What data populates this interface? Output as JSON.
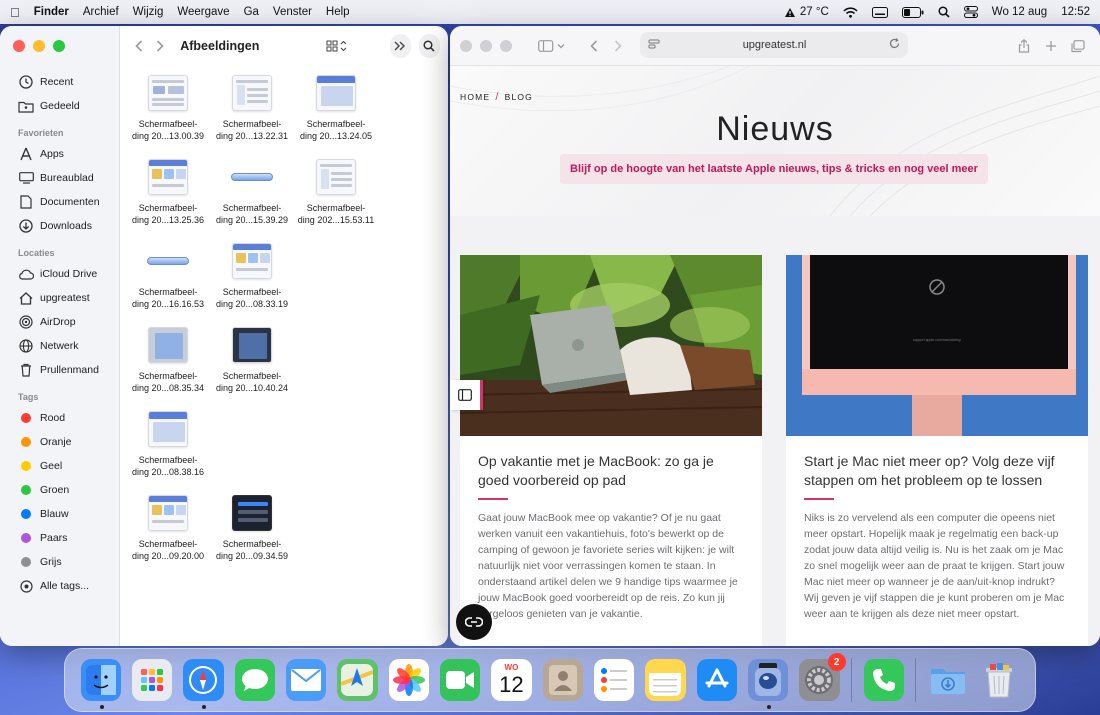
{
  "menubar": {
    "app_name": "Finder",
    "menus": [
      "Archief",
      "Wijzig",
      "Weergave",
      "Ga",
      "Venster",
      "Help"
    ],
    "weather": "27 °C",
    "date": "Wo 12 aug",
    "time": "12:52"
  },
  "finder": {
    "title": "Afbeeldingen",
    "sidebar": {
      "top_items": [
        {
          "label": "Recent",
          "icon": "clock-icon"
        },
        {
          "label": "Gedeeld",
          "icon": "shared-folder-icon"
        }
      ],
      "favorites_header": "Favorieten",
      "favorites": [
        {
          "label": "Apps",
          "icon": "apps-icon"
        },
        {
          "label": "Bureaublad",
          "icon": "desktop-icon"
        },
        {
          "label": "Documenten",
          "icon": "document-icon"
        },
        {
          "label": "Downloads",
          "icon": "download-icon"
        }
      ],
      "locations_header": "Locaties",
      "locations": [
        {
          "label": "iCloud Drive",
          "icon": "cloud-icon"
        },
        {
          "label": "upgreatest",
          "icon": "home-icon"
        },
        {
          "label": "AirDrop",
          "icon": "airdrop-icon"
        },
        {
          "label": "Netwerk",
          "icon": "network-icon"
        },
        {
          "label": "Prullenmand",
          "icon": "trash-icon"
        }
      ],
      "tags_header": "Tags",
      "tags": [
        {
          "label": "Rood",
          "color": "#ff3b30"
        },
        {
          "label": "Oranje",
          "color": "#ff9500"
        },
        {
          "label": "Geel",
          "color": "#ffcc00"
        },
        {
          "label": "Groen",
          "color": "#28c840"
        },
        {
          "label": "Blauw",
          "color": "#007aff"
        },
        {
          "label": "Paars",
          "color": "#af52de"
        },
        {
          "label": "Grijs",
          "color": "#8e8e93"
        },
        {
          "label": "Alle tags...",
          "color": ""
        }
      ]
    },
    "files": [
      {
        "line1": "Schermafbeel-",
        "line2": "ding 20...13.00.39"
      },
      {
        "line1": "Schermafbeel-",
        "line2": "ding 20...13.22.31"
      },
      {
        "line1": "Schermafbeel-",
        "line2": "ding 20...13.24.05"
      },
      {
        "line1": "Schermafbeel-",
        "line2": "ding 20...13.25.36"
      },
      {
        "line1": "Schermafbeel-",
        "line2": "ding 20...15.39.29"
      },
      {
        "line1": "Schermafbeel-",
        "line2": "ding 202...15.53.11"
      },
      {
        "line1": "Schermafbeel-",
        "line2": "ding 20...16.16.53"
      },
      {
        "line1": "Schermafbeel-",
        "line2": "ding 20...08.33.19"
      },
      {
        "line1": "Schermafbeel-",
        "line2": "ding 20...08.35.34"
      },
      {
        "line1": "Schermafbeel-",
        "line2": "ding 20...10.40.24"
      },
      {
        "line1": "Schermafbeel-",
        "line2": "ding 20...08.38.16"
      },
      {
        "line1": "Schermafbeel-",
        "line2": "ding 20...09.20.00"
      },
      {
        "line1": "Schermafbeel-",
        "line2": "ding 20...09.34.59"
      }
    ]
  },
  "safari": {
    "url": "upgreatest.nl",
    "breadcrumb": {
      "home": "HOME",
      "blog": "BLOG"
    },
    "heading": "Nieuws",
    "tagline": "Blijf op de hoogte van het laatste Apple nieuws, tips & tricks en nog veel meer",
    "cards": [
      {
        "title": "Op vakantie met je MacBook: zo ga je goed voorbereid op pad",
        "excerpt": "Gaat jouw MacBook mee op vakantie? Of je nu gaat werken vanuit een vakantiehuis, foto's bewerkt op de camping of gewoon je favoriete series wilt kijken: je wilt natuurlijk niet voor verrassingen komen te staan. In onderstaand artikel delen we 9 handige tips waarmee je jouw MacBook goed voorbereidt op de reis. Zo kun jij zorgeloos genieten van je vakantie."
      },
      {
        "title": "Start je Mac niet meer op? Volg deze vijf stappen om het probleem op te lossen",
        "excerpt": "Niks is zo vervelend als een computer die opeens niet meer opstart. Hopelijk maak je regelmatig een back-up zodat jouw data altijd veilig is. Nu is het zaak om je Mac zo snel mogelijk weer aan de praat te krijgen. Start jouw Mac niet meer op wanneer je de aan/uit-knop indrukt? Wij geven je vijf stappen die je kunt proberen om je Mac weer aan te krijgen als deze niet meer opstart."
      }
    ],
    "monitor_caption": "support.apple.com/mac/startup"
  },
  "dock": {
    "apps": [
      {
        "name": "Finder",
        "icon": "finder-icon",
        "color": "#3a8ef6",
        "running": true
      },
      {
        "name": "Launchpad",
        "icon": "launchpad-icon",
        "color": "#e9ebf0",
        "running": false
      },
      {
        "name": "Safari",
        "icon": "safari-icon",
        "color": "#2f8cf5",
        "running": true
      },
      {
        "name": "Berichten",
        "icon": "messages-icon",
        "color": "#34c759",
        "running": false
      },
      {
        "name": "Mail",
        "icon": "mail-icon",
        "color": "#4a9cf7",
        "running": false
      },
      {
        "name": "Kaarten",
        "icon": "maps-icon",
        "color": "#5fc26b",
        "running": false
      },
      {
        "name": "Foto's",
        "icon": "photos-icon",
        "color": "#ffffff",
        "running": false
      },
      {
        "name": "FaceTime",
        "icon": "facetime-icon",
        "color": "#33c35a",
        "running": false
      },
      {
        "name": "Agenda",
        "icon": "calendar-icon",
        "color": "#ffffff",
        "running": false,
        "month": "WO",
        "day": "12"
      },
      {
        "name": "Contacten",
        "icon": "contacts-icon",
        "color": "#b8a795",
        "running": false
      },
      {
        "name": "Herinneringen",
        "icon": "reminders-icon",
        "color": "#ffffff",
        "running": false
      },
      {
        "name": "Notities",
        "icon": "notes-icon",
        "color": "#ffd84d",
        "running": false
      },
      {
        "name": "App Store",
        "icon": "appstore-icon",
        "color": "#1f8cf5",
        "running": false
      },
      {
        "name": "Voorvertoning",
        "icon": "preview-icon",
        "color": "#6f8fd8",
        "running": true
      },
      {
        "name": "Systeeminstellingen",
        "icon": "settings-icon",
        "color": "#8e8e93",
        "running": false,
        "badge": "2"
      },
      {
        "name": "Telefoon",
        "icon": "phone-icon",
        "color": "#34c759",
        "running": false
      },
      {
        "name": "Downloads",
        "icon": "downloads-folder-icon",
        "color": "#7fb3ea",
        "running": false
      },
      {
        "name": "Prullenmand",
        "icon": "trash-icon",
        "color": "#dfe3ea",
        "running": false
      }
    ]
  }
}
